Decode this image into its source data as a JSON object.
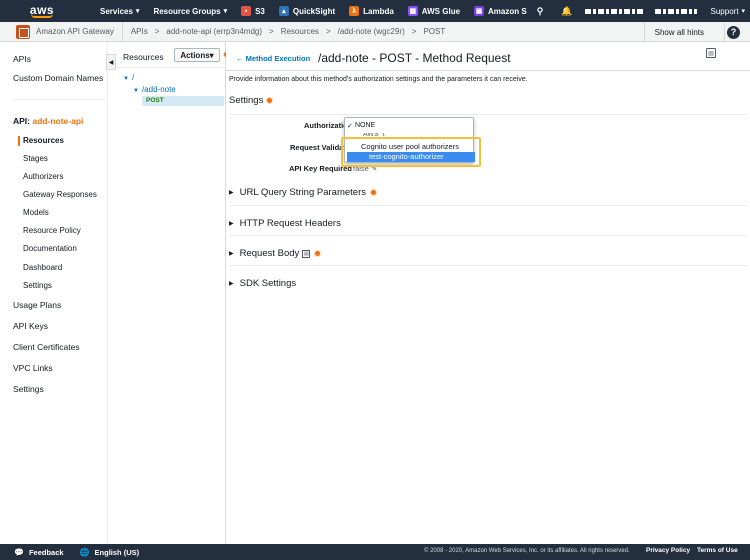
{
  "topnav": {
    "logo": "aws",
    "services": "Services",
    "resource_groups": "Resource Groups",
    "shortcuts": [
      {
        "label": "S3",
        "icon": "s3-icon",
        "color": "#e25444"
      },
      {
        "label": "QuickSight",
        "icon": "quicksight-icon",
        "color": "#2e73b8"
      },
      {
        "label": "Lambda",
        "icon": "lambda-icon",
        "color": "#ec7211"
      },
      {
        "label": "AWS Glue",
        "icon": "glue-icon",
        "color": "#8c4fff"
      },
      {
        "label": "Amazon S",
        "icon": "amazon-s-icon",
        "color": "#7b3fe4"
      }
    ],
    "support": "Support"
  },
  "breadcrumbs": {
    "service": "Amazon API Gateway",
    "items": [
      "APIs",
      "add-note-api (errp3n4mdg)",
      "Resources",
      "/add-note (wgc29r)",
      "POST"
    ],
    "hints": "Show all hints"
  },
  "sidebar": {
    "top_links": [
      "APIs",
      "Custom Domain Names"
    ],
    "api_prefix": "API:",
    "api_name": "add-note-api",
    "sub_items": [
      "Resources",
      "Stages",
      "Authorizers",
      "Gateway Responses",
      "Models",
      "Resource Policy",
      "Documentation",
      "Dashboard",
      "Settings"
    ],
    "bottom_links": [
      "Usage Plans",
      "API Keys",
      "Client Certificates",
      "VPC Links",
      "Settings"
    ]
  },
  "resources": {
    "title": "Resources",
    "actions": "Actions",
    "tree": {
      "root": "/",
      "child": "/add-note",
      "method": "POST"
    }
  },
  "main": {
    "back_link": "Method Execution",
    "title": "/add-note - POST - Method Request",
    "info": "Provide information about this method's authorization settings and the parameters it can receive.",
    "settings_title": "Settings",
    "fields": {
      "authorization": "Authorization",
      "request_validator": "Request Validat",
      "api_key_required": "API Key Required",
      "api_key_value": "false"
    },
    "sections": [
      "URL Query String Parameters",
      "HTTP Request Headers",
      "Request Body",
      "SDK Settings"
    ]
  },
  "dropdown": {
    "none": "NONE",
    "aws_iam": "AWS_IAM",
    "group": "Cognito user pool authorizers",
    "selected": "test-cognito-authorizer"
  },
  "colors": {
    "nav_bg": "#232f3e",
    "accent_orange": "#ec7211",
    "link_blue": "#0073bb",
    "highlight": "#f0c23b",
    "selected_blue": "#3b8cf0"
  },
  "footer": {
    "feedback": "Feedback",
    "language": "English (US)",
    "copyright": "© 2008 - 2020, Amazon Web Services, Inc. or its affiliates. All rights reserved.",
    "privacy": "Privacy Policy",
    "terms": "Terms of Use"
  }
}
